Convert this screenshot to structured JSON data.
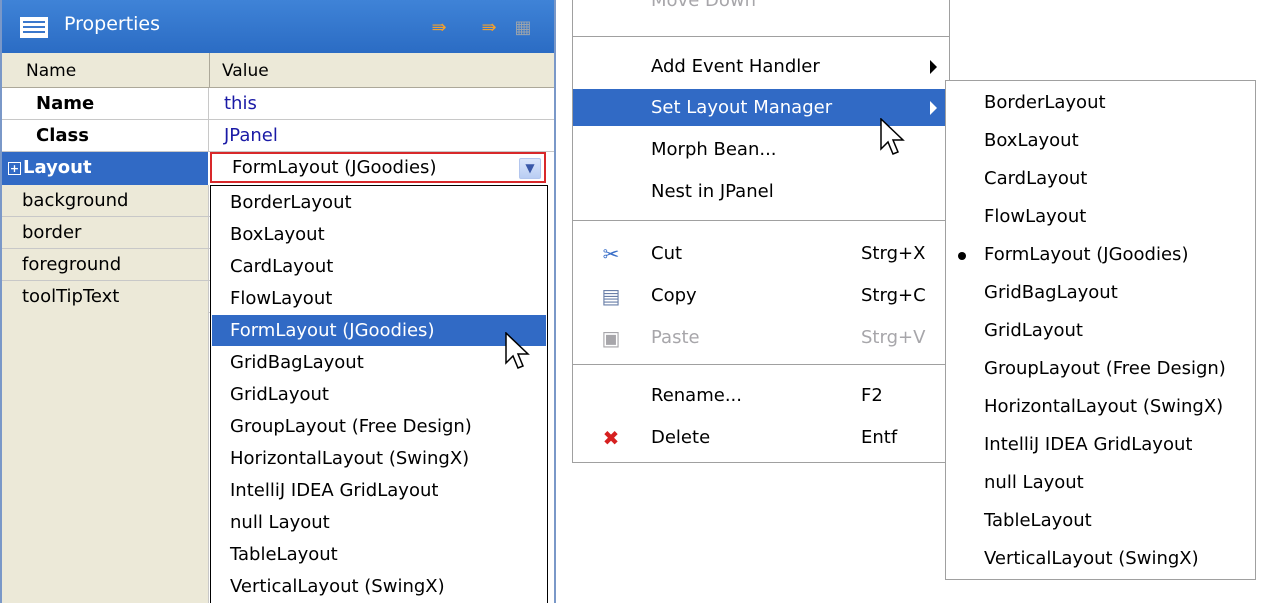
{
  "properties_panel": {
    "title": "Properties",
    "columns": {
      "name": "Name",
      "value": "Value"
    },
    "rows": [
      {
        "name": "Name",
        "value": "this"
      },
      {
        "name": "Class",
        "value": "JPanel"
      },
      {
        "name": "Layout",
        "value": "FormLayout (JGoodies)"
      },
      {
        "name": "background",
        "value": ""
      },
      {
        "name": "border",
        "value": ""
      },
      {
        "name": "foreground",
        "value": ""
      },
      {
        "name": "toolTipText",
        "value": ""
      }
    ],
    "dropdown_options": [
      "BorderLayout",
      "BoxLayout",
      "CardLayout",
      "FlowLayout",
      "FormLayout (JGoodies)",
      "GridBagLayout",
      "GridLayout",
      "GroupLayout (Free Design)",
      "HorizontalLayout (SwingX)",
      "IntelliJ IDEA GridLayout",
      "null Layout",
      "TableLayout",
      "VerticalLayout (SwingX)"
    ],
    "selected_option": "FormLayout (JGoodies)"
  },
  "context_menu": {
    "items": [
      {
        "label": "Move Down",
        "shortcut": ""
      },
      {
        "label": "Add Event Handler",
        "shortcut": ""
      },
      {
        "label": "Set Layout Manager",
        "shortcut": ""
      },
      {
        "label": "Morph Bean...",
        "shortcut": ""
      },
      {
        "label": "Nest in JPanel",
        "shortcut": ""
      },
      {
        "label": "Cut",
        "shortcut": "Strg+X"
      },
      {
        "label": "Copy",
        "shortcut": "Strg+C"
      },
      {
        "label": "Paste",
        "shortcut": "Strg+V"
      },
      {
        "label": "Rename...",
        "shortcut": "F2"
      },
      {
        "label": "Delete",
        "shortcut": "Entf"
      }
    ]
  },
  "layout_submenu": {
    "items": [
      "BorderLayout",
      "BoxLayout",
      "CardLayout",
      "FlowLayout",
      "FormLayout (JGoodies)",
      "GridBagLayout",
      "GridLayout",
      "GroupLayout (Free Design)",
      "HorizontalLayout (SwingX)",
      "IntelliJ IDEA GridLayout",
      "null Layout",
      "TableLayout",
      "VerticalLayout (SwingX)"
    ],
    "checked": "FormLayout (JGoodies)"
  },
  "colors": {
    "selection": "#316ac5",
    "title_bar": "#2b6cc4",
    "combo_border": "#d8282a",
    "disabled_text": "#a7a6aa"
  },
  "icons": [
    "properties-icon",
    "expand-arrow-icon",
    "collapse-arrow-icon",
    "view-icon",
    "scissors-icon",
    "copy-icon",
    "paste-icon",
    "delete-icon",
    "mouse-pointer-icon"
  ]
}
